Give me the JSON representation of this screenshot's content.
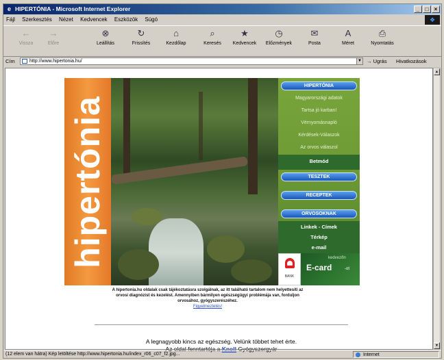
{
  "window": {
    "title": "HIPERTÓNIA - Microsoft Internet Explorer",
    "controls": [
      "_",
      "□",
      "×"
    ]
  },
  "menubar": {
    "items": [
      "Fájl",
      "Szerkesztés",
      "Nézet",
      "Kedvencek",
      "Eszközök",
      "Súgó"
    ]
  },
  "toolbar": {
    "buttons": [
      {
        "label": "Vissza",
        "icon": "back-arrow-icon"
      },
      {
        "label": "Előre",
        "icon": "forward-arrow-icon"
      },
      {
        "label": "Leállítás",
        "icon": "stop-icon"
      },
      {
        "label": "Frissítés",
        "icon": "refresh-icon"
      },
      {
        "label": "Kezdőlap",
        "icon": "home-icon"
      },
      {
        "label": "Keresés",
        "icon": "search-icon"
      },
      {
        "label": "Kedvencek",
        "icon": "favorites-icon"
      },
      {
        "label": "Előzmények",
        "icon": "history-icon"
      },
      {
        "label": "Posta",
        "icon": "mail-icon"
      },
      {
        "label": "Méret",
        "icon": "font-size-icon"
      },
      {
        "label": "Nyomtatás",
        "icon": "print-icon"
      }
    ]
  },
  "address": {
    "label": "Cím",
    "url": "http://www.hipertonia.hu/",
    "go_label": "Ugrás",
    "links_label": "Hivatkozások"
  },
  "banner": {
    "logo_text": "hipertónia",
    "menu": {
      "section1": "HIPERTÓNIA",
      "links1": [
        "Magyarországi adatok",
        "Tartsa jó karban!",
        "Vérnyomásnapló",
        "Kérdések-Válaszok",
        "Az orvos válaszol"
      ],
      "betmod": "Betmód",
      "section2": "TESZTEK",
      "section3": "RECEPTEK",
      "section4": "ORVOSOKNAK",
      "links2": [
        "Linkek - Címek",
        "Térkép",
        "e-mail"
      ]
    },
    "ad": {
      "brand": "BANK",
      "ecard_text": "E-card",
      "ecard_suffix": "-ot",
      "ecard_top": "kedvezőn"
    }
  },
  "disclaimer": {
    "text": "A hipertonia.hu oldalak csak tájékoztatásra szolgálnak, az itt található tartalom nem helyettesíti az orvosi diagnózist és kezelést. Amennyiben bármilyen egészségügyi problémája van, forduljon orvosához, gyógyszerészéhez.",
    "warning_link": "Figyelmeztetés!"
  },
  "footer": {
    "line1": "A legnagyobb kincs az egészség. Velünk többet tehet érte.",
    "line2_prefix": "Az oldal fenntartója a",
    "line2_link": "Knoll",
    "line2_suffix": "Gyógyszergyár"
  },
  "status": {
    "text": "(12 elem van hátra) Kép letöltése http://www.hipertonia.hu/index_r06_c07_f2.jpg...",
    "zone": "Internet"
  }
}
